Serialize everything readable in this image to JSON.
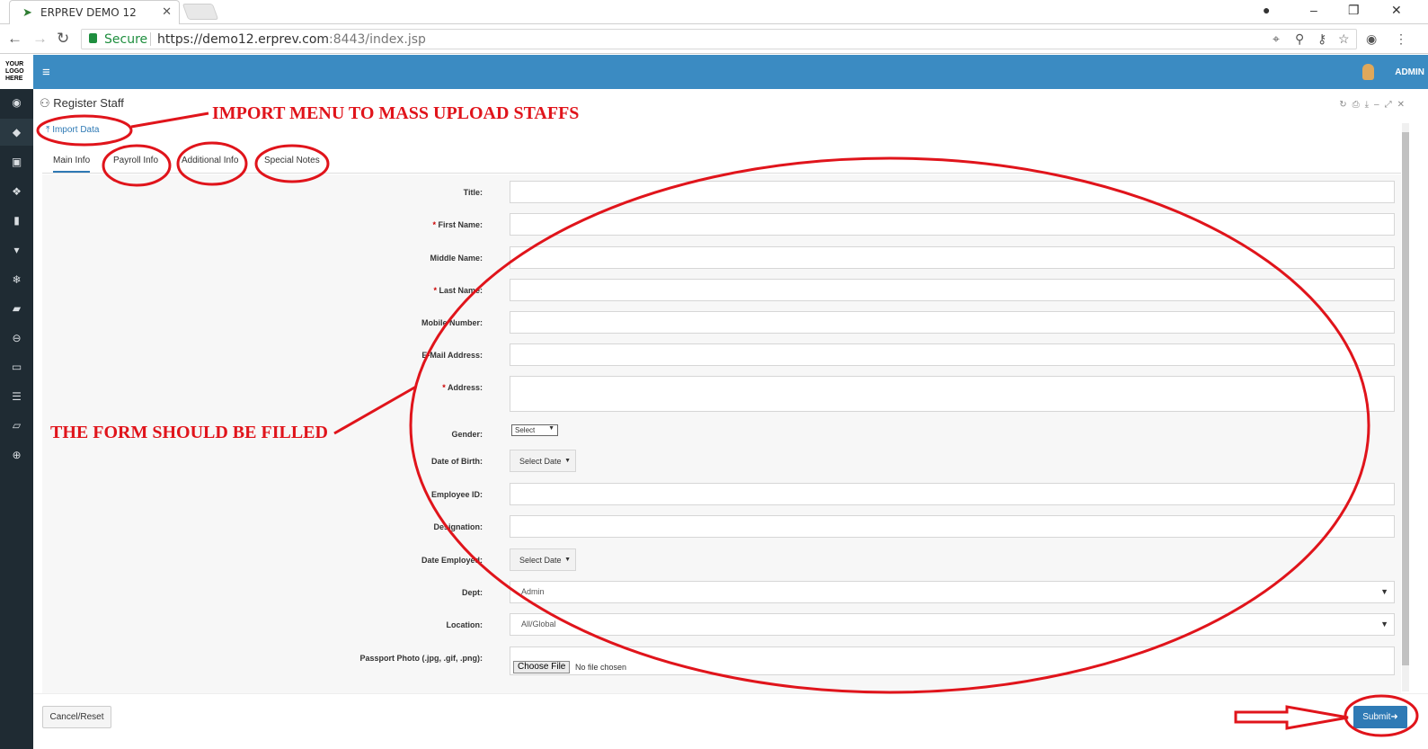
{
  "browser": {
    "tab_title": "ERPREV DEMO 12",
    "tab_close": "✕",
    "secure_label": "Secure",
    "url_scheme_host": "https://demo12.erprev.com",
    "url_rest": ":8443/index.jsp"
  },
  "app": {
    "logo_text": "YOUR LOGO HERE",
    "user_name": "ADMIN",
    "sidebar_icons": [
      "dashboard-icon",
      "tag-icon",
      "money-icon",
      "cubes-icon",
      "building-icon",
      "database-icon",
      "snowflake-icon",
      "cart-icon",
      "circle-icon",
      "desktop-icon",
      "storage-icon",
      "book-icon",
      "globe-icon"
    ]
  },
  "panel": {
    "title": "Register Staff",
    "import_label": "Import Data",
    "tabs": [
      "Main Info",
      "Payroll Info",
      "Additional Info",
      "Special Notes"
    ]
  },
  "form": {
    "title_label": "Title:",
    "first_name_label": "First Name:",
    "middle_name_label": "Middle Name:",
    "last_name_label": "Last Name:",
    "mobile_label": "Mobile Number:",
    "email_label": "E-Mail Address:",
    "address_label": "Address:",
    "gender_label": "Gender:",
    "gender_value": "Select",
    "dob_label": "Date of Birth:",
    "dob_button": "Select Date",
    "employee_id_label": "Employee ID:",
    "designation_label": "Designation:",
    "date_employed_label": "Date Employed:",
    "date_employed_button": "Select Date",
    "dept_label": "Dept:",
    "dept_value": "Admin",
    "location_label": "Location:",
    "location_value": "All/Global",
    "photo_label": "Passport Photo (.jpg, .gif, .png):",
    "choose_file": "Choose File",
    "no_file": "No file chosen",
    "required_mark": "*"
  },
  "footer": {
    "cancel_label": "Cancel/Reset",
    "submit_label": "Submit"
  },
  "annotations": {
    "import_note": "IMPORT MENU TO MASS UPLOAD STAFFS",
    "form_note": "THE FORM SHOULD BE FILLED",
    "color": "#e0141b"
  }
}
